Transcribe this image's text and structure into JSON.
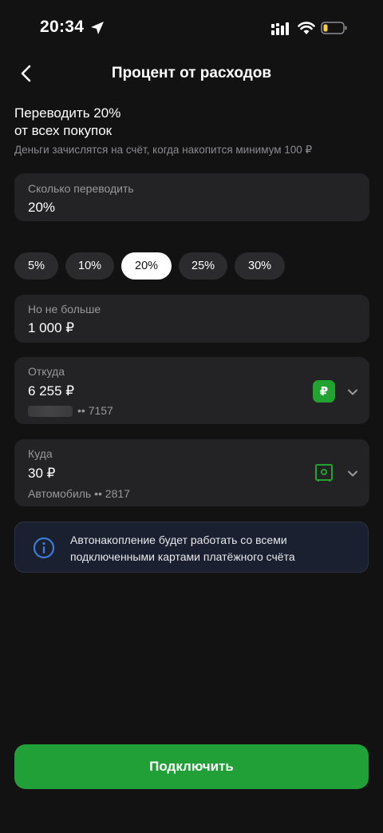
{
  "status_bar": {
    "time": "20:34",
    "icons": [
      "location-arrow-icon",
      "signal-icon",
      "wifi-icon",
      "battery-low-icon"
    ]
  },
  "header": {
    "back_icon": "chevron-left-icon",
    "title": "Процент от расходов"
  },
  "intro": {
    "line1": "Переводить 20%",
    "line2": "от всех покупок",
    "note": "Деньги зачислятся на счёт, когда накопится минимум 100 ₽"
  },
  "amount_field": {
    "label": "Сколько переводить",
    "value": "20%"
  },
  "percent_chips": [
    {
      "label": "5%",
      "selected": false
    },
    {
      "label": "10%",
      "selected": false
    },
    {
      "label": "20%",
      "selected": true
    },
    {
      "label": "25%",
      "selected": false
    },
    {
      "label": "30%",
      "selected": false
    }
  ],
  "limit_field": {
    "label": "Но не больше",
    "value": "1 000 ₽"
  },
  "from_field": {
    "label": "Откуда",
    "value": "6 255 ₽",
    "account": "•• 7157",
    "badge": "₽"
  },
  "to_field": {
    "label": "Куда",
    "value": "30 ₽",
    "account": "Автомобиль •• 2817",
    "icon": "safe-icon"
  },
  "info": {
    "icon": "info-circle-icon",
    "text": "Автонакопление будет работать со всеми подключенными картами платёжного счёта"
  },
  "connect_button": {
    "label": "Подключить"
  },
  "colors": {
    "background": "#121212",
    "card": "#232325",
    "accent_green": "#21a038",
    "info_blue": "#3d7bd9"
  }
}
